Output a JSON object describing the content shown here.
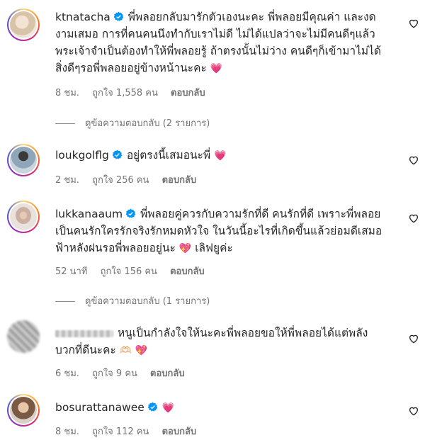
{
  "comments": [
    {
      "username": "ktnatacha",
      "verified": true,
      "lines": [
        "พี่พลอยกลับมารักตัวเองนะคะ พี่พลอยมีคุณค่า และงด",
        "งามเสมอ การที่คนคนนึงทำกับเราไม่ดี ไม่ได้แปลว่าจะไม่มีคนดีๆแล้ว",
        "พระเจ้าจำเป็นต้องทำให้พี่พลอยรู้ ถ้าตรงนั้นไม่ว่าง คนดีๆก็เข้ามาไม่ได้",
        "สิ่งดีๆรอพี่พลอยอยู่ข้างหน้านะคะ"
      ],
      "emoji": "💗",
      "time": "8 ชม.",
      "likes": "ถูกใจ 1,558 คน",
      "reply": "ตอบกลับ",
      "view_replies": "ดูข้อความตอบกลับ (2 รายการ)"
    },
    {
      "username": "loukgolflg",
      "verified": true,
      "lines": [
        "อยู่ตรงนี้เสมอนะพี่"
      ],
      "emoji": "💗",
      "time": "2 ชม.",
      "likes": "ถูกใจ 256 คน",
      "reply": "ตอบกลับ"
    },
    {
      "username": "lukkanaaum",
      "verified": true,
      "lines": [
        "พี่พลอยคู่ควรกับความรักที่ดี คนรักที่ดี เพราะพี่พลอย",
        "เป็นคนรักใครรักจริงรักหมดหัวใจ ในวันนี้อะไรที่เกิดขึ้นแล้วย่อมดีเสมอ",
        "ฟ้าหลังฝนรอพี่พลอยอยู่นะ"
      ],
      "emoji": "💖",
      "suffix": "เลิฟยูค่ะ",
      "time": "52 นาที",
      "likes": "ถูกใจ 156 คน",
      "reply": "ตอบกลับ",
      "view_replies": "ดูข้อความตอบกลับ (1 รายการ)"
    },
    {
      "username": "",
      "verified": false,
      "lines": [
        "หนูเป็นกำลังใจให้นะคะพี่พลอยขอให้พี่พลอยได้แต่พลัง",
        "บวกที่ดีนะคะ"
      ],
      "emoji": "🫶🏻 💖",
      "time": "6 ชม.",
      "likes": "ถูกใจ 9 คน",
      "reply": "ตอบกลับ"
    },
    {
      "username": "bosurattanawee",
      "verified": true,
      "lines": [
        ""
      ],
      "emoji": "💗",
      "time": "8 ชม.",
      "likes": "ถูกใจ 112 คน",
      "reply": "ตอบกลับ"
    }
  ],
  "icons": {
    "verified": "verified-badge-icon",
    "like": "heart-outline-icon",
    "verified_color": "#0095f6"
  }
}
